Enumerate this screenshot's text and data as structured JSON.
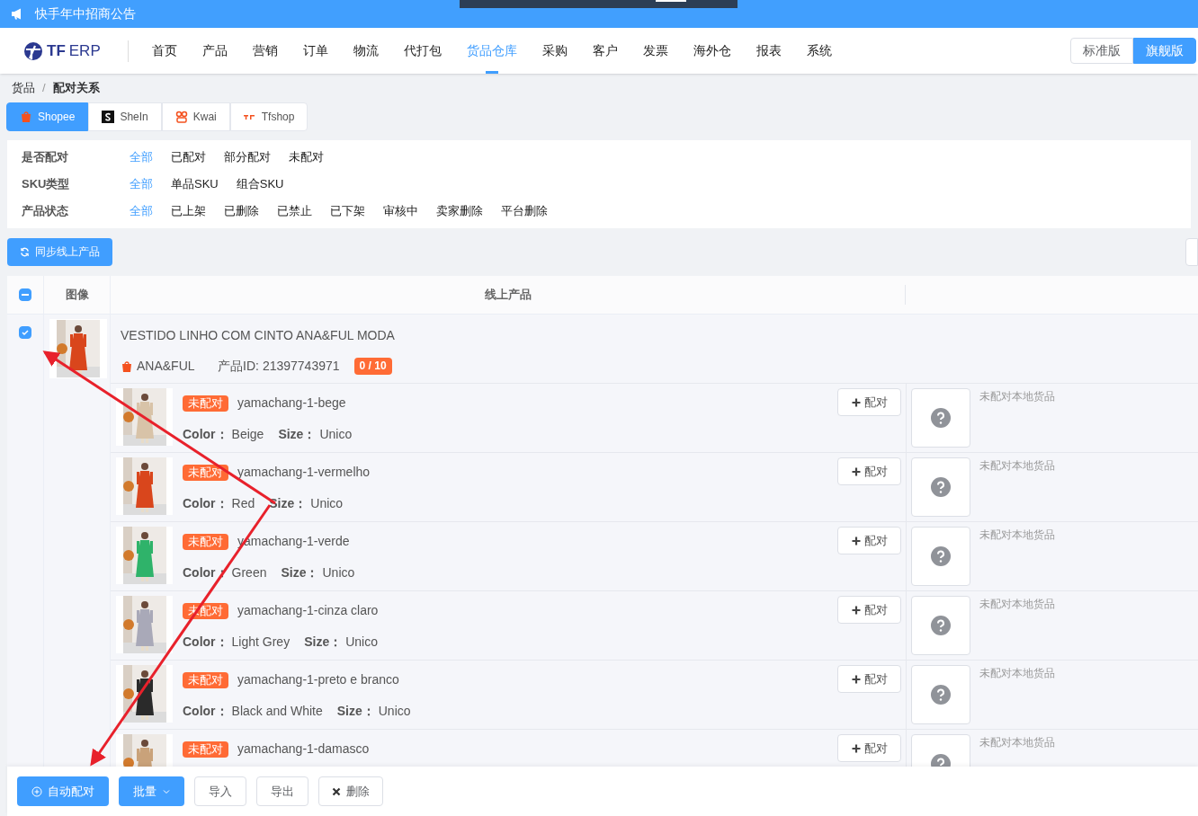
{
  "announcement": {
    "text": "快手年中招商公告"
  },
  "logo": {
    "bold": "TF",
    "light": "ERP"
  },
  "nav": [
    {
      "label": "首页",
      "selected": false
    },
    {
      "label": "产品",
      "selected": false
    },
    {
      "label": "营销",
      "selected": false
    },
    {
      "label": "订单",
      "selected": false
    },
    {
      "label": "物流",
      "selected": false
    },
    {
      "label": "代打包",
      "selected": false
    },
    {
      "label": "货品仓库",
      "selected": true
    },
    {
      "label": "采购",
      "selected": false
    },
    {
      "label": "客户",
      "selected": false
    },
    {
      "label": "发票",
      "selected": false
    },
    {
      "label": "海外仓",
      "selected": false
    },
    {
      "label": "报表",
      "selected": false
    },
    {
      "label": "系统",
      "selected": false
    }
  ],
  "editions": [
    {
      "label": "标准版",
      "selected": false
    },
    {
      "label": "旗舰版",
      "selected": true
    }
  ],
  "breadcrumb": [
    "货品",
    "配对关系"
  ],
  "breadcrumb_separator": "/",
  "platform_tabs": [
    {
      "label": "Shopee",
      "kind": "shopee",
      "selected": true
    },
    {
      "label": "SheIn",
      "kind": "shein",
      "selected": false
    },
    {
      "label": "Kwai",
      "kind": "kwai",
      "selected": false
    },
    {
      "label": "Tfshop",
      "kind": "tfshop",
      "selected": false
    }
  ],
  "filters": [
    {
      "label": "是否配对",
      "options": [
        {
          "label": "全部",
          "selected": true
        },
        {
          "label": "已配对",
          "selected": false
        },
        {
          "label": "部分配对",
          "selected": false
        },
        {
          "label": "未配对",
          "selected": false
        }
      ]
    },
    {
      "label": "SKU类型",
      "options": [
        {
          "label": "全部",
          "selected": true
        },
        {
          "label": "单品SKU",
          "selected": false
        },
        {
          "label": "组合SKU",
          "selected": false
        }
      ]
    },
    {
      "label": "产品状态",
      "options": [
        {
          "label": "全部",
          "selected": true
        },
        {
          "label": "已上架",
          "selected": false
        },
        {
          "label": "已删除",
          "selected": false
        },
        {
          "label": "已禁止",
          "selected": false
        },
        {
          "label": "已下架",
          "selected": false
        },
        {
          "label": "审核中",
          "selected": false
        },
        {
          "label": "卖家删除",
          "selected": false
        },
        {
          "label": "平台删除",
          "selected": false
        }
      ]
    }
  ],
  "sync_button": "同步线上产品",
  "table": {
    "header_indeterminate": true,
    "columns": [
      "图像",
      "线上产品"
    ],
    "product": {
      "checked": true,
      "title": "VESTIDO LINHO COM CINTO ANA&FUL MODA",
      "shop": "ANA&FUL",
      "id_label": "产品ID:",
      "id": "21397743971",
      "count": "0 / 10",
      "variants": [
        {
          "status": "未配对",
          "sku": "yamachang-1-bege",
          "color_label": "Color：",
          "color_value": "Beige",
          "size_label": "Size：",
          "size": "Unico",
          "pair_button": "配对",
          "local": "未配对本地货品"
        },
        {
          "status": "未配对",
          "sku": "yamachang-1-vermelho",
          "color_label": "Color：",
          "color_value": "Red",
          "size_label": "Size：",
          "size": "Unico",
          "pair_button": "配对",
          "local": "未配对本地货品"
        },
        {
          "status": "未配对",
          "sku": "yamachang-1-verde",
          "color_label": "Color：",
          "color_value": "Green",
          "size_label": "Size：",
          "size": "Unico",
          "pair_button": "配对",
          "local": "未配对本地货品"
        },
        {
          "status": "未配对",
          "sku": "yamachang-1-cinza claro",
          "color_label": "Color：",
          "color_value": "Light Grey",
          "size_label": "Size：",
          "size": "Unico",
          "pair_button": "配对",
          "local": "未配对本地货品"
        },
        {
          "status": "未配对",
          "sku": "yamachang-1-preto e branco",
          "color_label": "Color：",
          "color_value": "Black and White",
          "size_label": "Size：",
          "size": "Unico",
          "pair_button": "配对",
          "local": "未配对本地货品"
        },
        {
          "status": "未配对",
          "sku": "yamachang-1-damasco",
          "pair_button": "配对",
          "local": "未配对本地货品"
        }
      ]
    }
  },
  "bottom_buttons": [
    {
      "label": "自动配对",
      "kind": "auto"
    },
    {
      "label": "批量",
      "kind": "dropdown"
    },
    {
      "label": "导入",
      "kind": "plain"
    },
    {
      "label": "导出",
      "kind": "plain"
    },
    {
      "label": "删除",
      "kind": "delete"
    }
  ]
}
